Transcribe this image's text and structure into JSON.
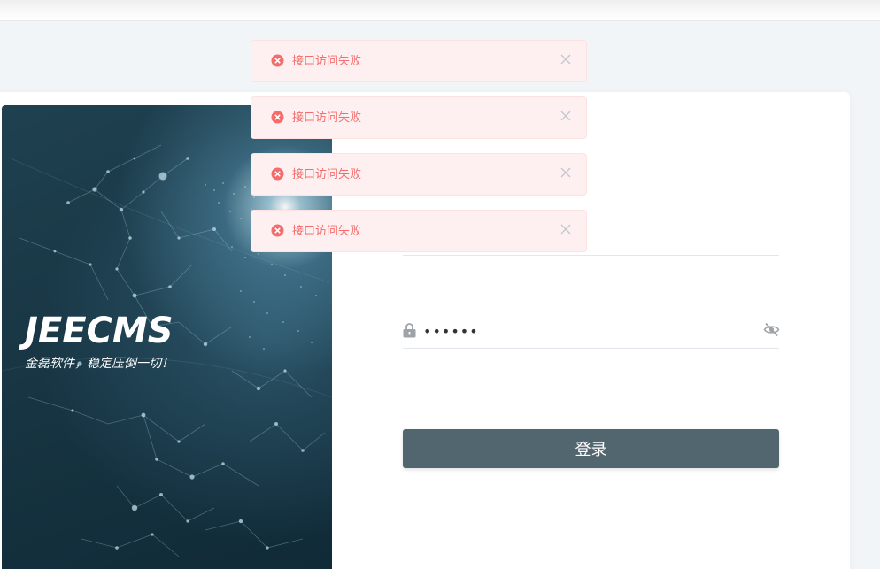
{
  "brand": {
    "logo_text": "JEECMS",
    "slogan": "金磊软件，稳定压倒一切！"
  },
  "login_form": {
    "password": {
      "value": "••••••",
      "lock_icon": "lock-icon",
      "visibility_icon": "eye-off-icon"
    },
    "submit_label": "登录"
  },
  "notifications": [
    {
      "type": "error",
      "icon": "error-circle-icon",
      "message": "接口访问失败"
    },
    {
      "type": "error",
      "icon": "error-circle-icon",
      "message": "接口访问失败"
    },
    {
      "type": "error",
      "icon": "error-circle-icon",
      "message": "接口访问失败"
    },
    {
      "type": "error",
      "icon": "error-circle-icon",
      "message": "接口访问失败"
    }
  ],
  "colors": {
    "error_text": "#f56c6c",
    "error_bg": "#fef0f0",
    "button_bg": "#51666f",
    "brand_panel": "#183644"
  }
}
